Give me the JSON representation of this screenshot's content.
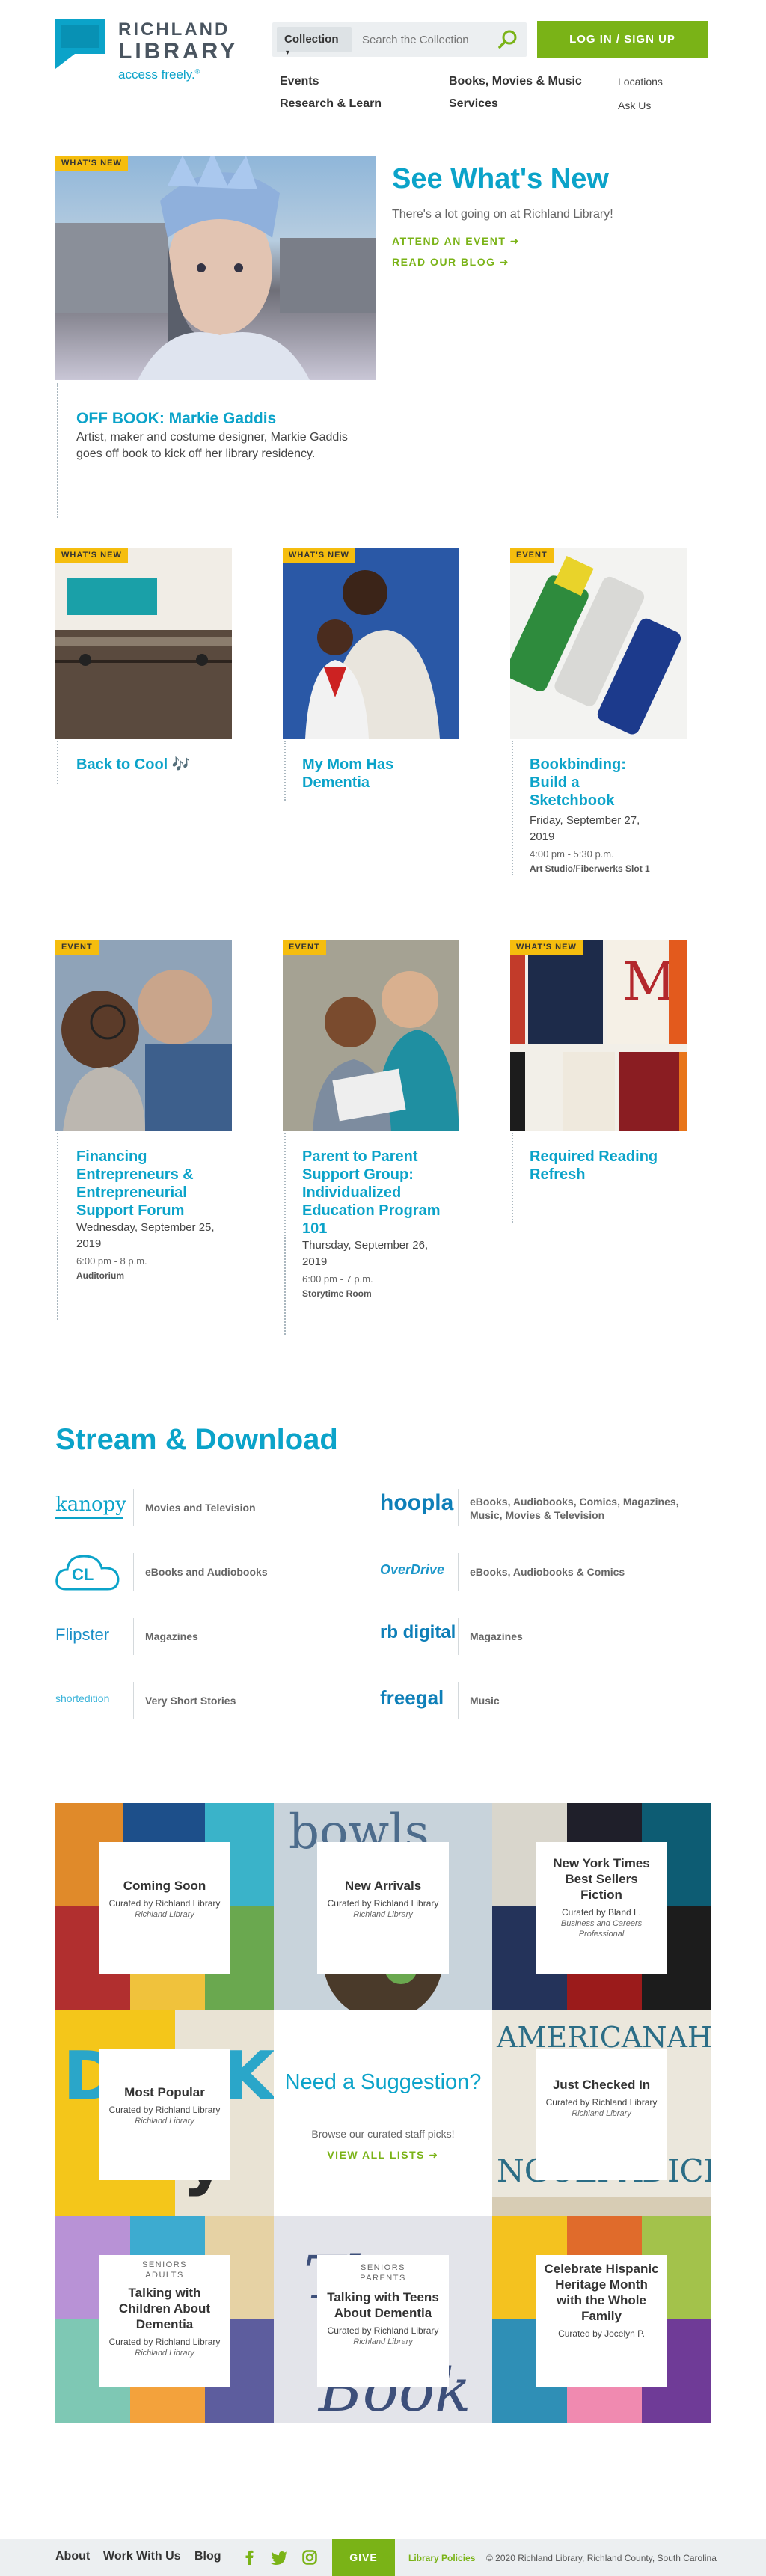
{
  "header": {
    "logo_line1": "RICHLAND",
    "logo_line2": "LIBRARY",
    "logo_tagline": "access freely.",
    "search_select": "Collection",
    "search_placeholder": "Search the Collection",
    "login_label": "LOG IN / SIGN UP",
    "nav": {
      "events": "Events",
      "research": "Research & Learn",
      "books": "Books, Movies & Music",
      "services": "Services",
      "locations": "Locations",
      "ask_us": "Ask Us"
    }
  },
  "hero": {
    "tag": "WHAT'S NEW",
    "heading": "See What's New",
    "intro": "There's a lot going on at Richland Library!",
    "attend_link": "ATTEND AN EVENT",
    "blog_link": "READ OUR BLOG",
    "feature_title": "OFF BOOK: Markie Gaddis",
    "feature_desc": "Artist, maker and costume designer, Markie Gaddis goes off book to kick off her library residency."
  },
  "cards_row1": [
    {
      "tag": "WHAT'S NEW",
      "title": "Back to Cool 🎶"
    },
    {
      "tag": "WHAT'S NEW",
      "title": "My Mom Has Dementia"
    },
    {
      "tag": "EVENT",
      "title": "Bookbinding: Build a Sketchbook",
      "date": "Friday, September 27, 2019",
      "time": "4:00 pm - 5:30 p.m.",
      "room": "Art Studio/Fiberwerks Slot 1"
    }
  ],
  "cards_row2": [
    {
      "tag": "EVENT",
      "title": "Financing Entrepreneurs & Entrepreneurial Support Forum",
      "date": "Wednesday, September 25, 2019",
      "time": "6:00 pm - 8 p.m.",
      "room": "Auditorium"
    },
    {
      "tag": "EVENT",
      "title": "Parent to Parent Support Group: Individualized Education Program 101",
      "date": "Thursday, September 26, 2019",
      "time": "6:00 pm - 7 p.m.",
      "room": "Storytime Room"
    },
    {
      "tag": "WHAT'S NEW",
      "title": "Required Reading Refresh"
    }
  ],
  "stream": {
    "heading": "Stream & Download",
    "services": [
      {
        "logo": "kanopy",
        "label": "Movies and Television"
      },
      {
        "logo": "hoopla",
        "label": "eBooks, Audiobooks, Comics, Magazines, Music, Movies & Television"
      },
      {
        "logo": "CL",
        "label": "eBooks and Audiobooks"
      },
      {
        "logo": "OverDrive",
        "label": "eBooks, Audiobooks & Comics"
      },
      {
        "logo": "Flipster",
        "label": "Magazines"
      },
      {
        "logo": "rb digital",
        "label": "Magazines"
      },
      {
        "logo": "shortedition",
        "label": "Very Short Stories"
      },
      {
        "logo": "freegal",
        "label": "Music"
      }
    ]
  },
  "lists": {
    "coming_soon": {
      "title": "Coming Soon",
      "by": "Curated by Richland Library",
      "sub": "Richland Library"
    },
    "new_arrivals": {
      "title": "New Arrivals",
      "by": "Curated by Richland Library",
      "sub": "Richland Library"
    },
    "nyt": {
      "title": "New York Times Best Sellers Fiction",
      "by": "Curated by Bland L.",
      "sub": "Business and Careers Professional"
    },
    "most_popular": {
      "title": "Most Popular",
      "by": "Curated by Richland Library",
      "sub": "Richland Library"
    },
    "suggestion": {
      "heading": "Need a Suggestion?",
      "desc": "Browse our curated staff picks!",
      "link": "VIEW ALL LISTS"
    },
    "just_checked": {
      "title": "Just Checked In",
      "by": "Curated by Richland Library",
      "sub": "Richland Library"
    },
    "talking_children": {
      "pre1": "SENIORS",
      "pre2": "ADULTS",
      "title": "Talking with Children About Dementia",
      "by": "Curated by Richland Library",
      "sub": "Richland Library"
    },
    "talking_teens": {
      "pre1": "SENIORS",
      "pre2": "PARENTS",
      "title": "Talking with Teens About Dementia",
      "by": "Curated by Richland Library",
      "sub": "Richland Library"
    },
    "hispanic": {
      "title": "Celebrate Hispanic Heritage Month with the Whole Family",
      "by": "Curated by Jocelyn P."
    }
  },
  "footer": {
    "about": "About",
    "work": "Work With Us",
    "blog": "Blog",
    "give": "GIVE",
    "policies": "Library Policies",
    "copyright": "© 2020 Richland Library, Richland County, South Carolina"
  },
  "colors": {
    "teal": "#0ba3c9",
    "green": "#7ab317",
    "tag_yellow": "#f5bd0e"
  }
}
